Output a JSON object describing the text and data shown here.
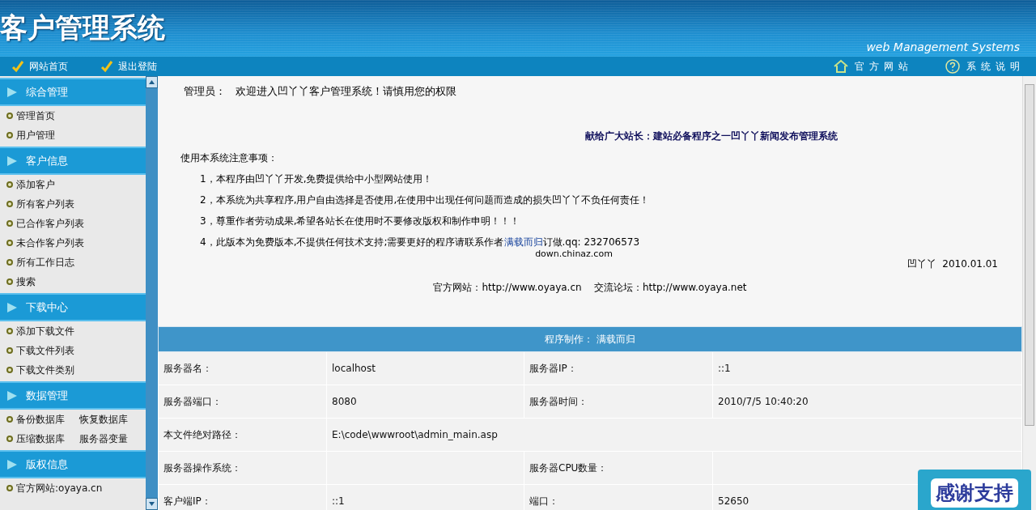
{
  "header": {
    "title": "客户管理系统",
    "subtitle": "web Management Systems"
  },
  "nav": {
    "left": [
      {
        "label": "网站首页"
      },
      {
        "label": "退出登陆"
      }
    ],
    "right": [
      {
        "label": "官方网站",
        "kind": "home"
      },
      {
        "label": "系统说明",
        "kind": "help"
      }
    ]
  },
  "sidebar": [
    {
      "title": "综合管理",
      "items": [
        [
          "管理首页"
        ],
        [
          "用户管理"
        ]
      ]
    },
    {
      "title": "客户信息",
      "items": [
        [
          "添加客户"
        ],
        [
          "所有客户列表"
        ],
        [
          "已合作客户列表"
        ],
        [
          "未合作客户列表"
        ],
        [
          "所有工作日志"
        ],
        [
          "搜索"
        ]
      ]
    },
    {
      "title": "下载中心",
      "items": [
        [
          "添加下载文件"
        ],
        [
          "下载文件列表"
        ],
        [
          "下载文件类别"
        ]
      ]
    },
    {
      "title": "数据管理",
      "items": [
        [
          "备份数据库",
          "恢复数据库"
        ],
        [
          "压缩数据库",
          "服务器变量"
        ]
      ]
    },
    {
      "title": "版权信息",
      "items": [
        [
          "官方网站:oyaya.cn"
        ]
      ]
    }
  ],
  "main": {
    "welcome_label": "管理员：",
    "welcome": "欢迎进入凹丫丫客户管理系统！请慎用您的权限",
    "dedication": "献给广大站长：建站必备程序之一凹丫丫新闻发布管理系统",
    "notes_title": "使用本系统注意事项：",
    "notes": [
      "1，本程序由凹丫丫开发,免费提供给中小型网站使用！",
      "2，本系统为共享程序,用户自由选择是否使用,在使用中出现任何问题而造成的损失凹丫丫不负任何责任！",
      "3，尊重作者劳动成果,希望各站长在使用时不要修改版权和制作申明！！！"
    ],
    "note4_text": "4，此版本为免费版本,不提供任何技术支持;需要更好的程序请联系作者",
    "note4_link": "满载而归",
    "note4_tail": "订做.qq: 232706573",
    "source": "down.chinaz.com",
    "signature": "凹丫丫  2010.01.01",
    "links": "官方网站：http://www.oyaya.cn    交流论坛：http://www.oyaya.net",
    "table": {
      "heading": "程序制作： 满载而归",
      "rows": [
        [
          "服务器名：",
          "localhost",
          "服务器IP：",
          "::1"
        ],
        [
          "服务器端口：",
          "8080",
          "服务器时间：",
          "2010/7/5 10:40:20"
        ],
        [
          "本文件绝对路径：",
          {
            "text": "E:\\code\\wwwroot\\admin_main.asp",
            "colspan": 3
          }
        ],
        [
          "服务器操作系统：",
          "",
          "服务器CPU数量：",
          ""
        ],
        [
          "客户端IP：",
          "::1",
          "端口：",
          "52650"
        ]
      ]
    }
  },
  "badge": "感谢支持"
}
